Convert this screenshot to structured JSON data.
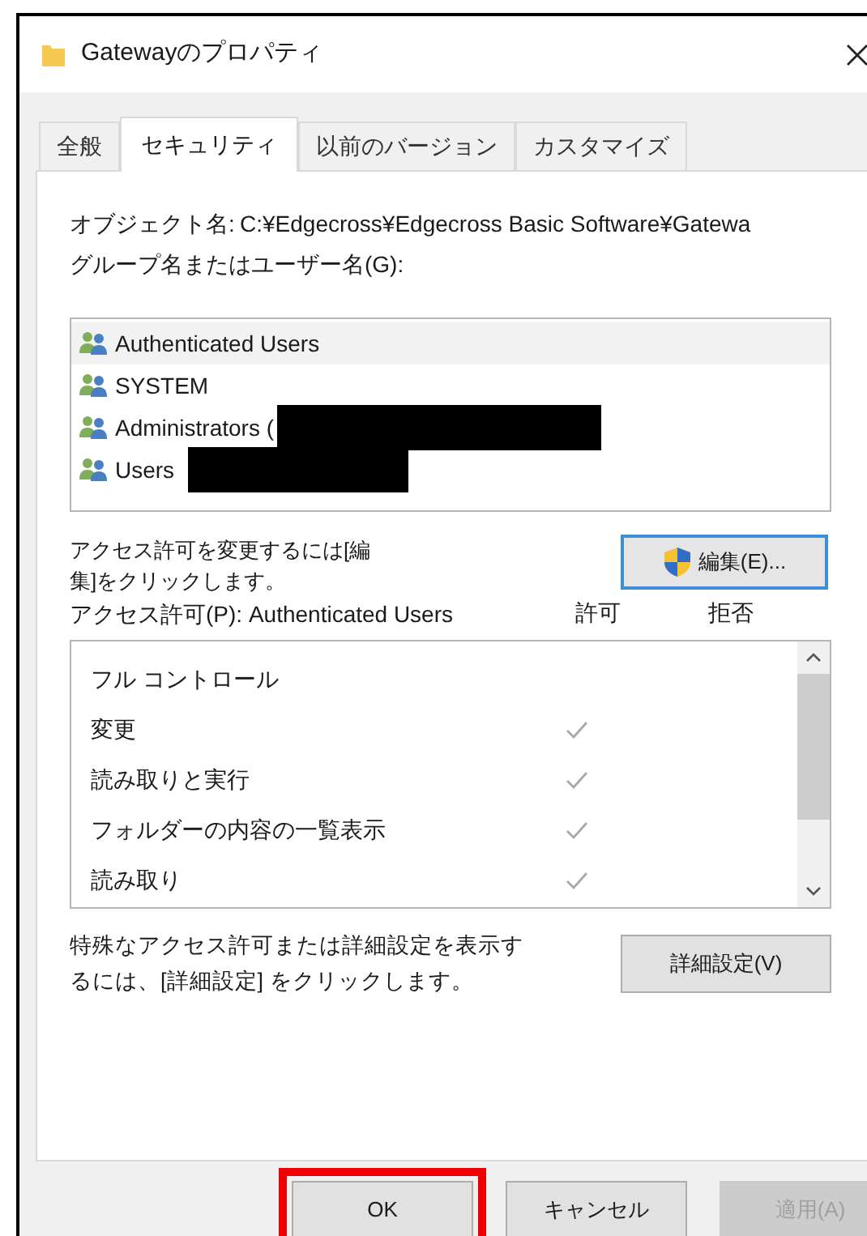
{
  "window": {
    "title": "Gatewayのプロパティ"
  },
  "tabs": [
    {
      "label": "全般",
      "selected": false
    },
    {
      "label": "セキュリティ",
      "selected": true
    },
    {
      "label": "以前のバージョン",
      "selected": false
    },
    {
      "label": "カスタマイズ",
      "selected": false
    }
  ],
  "object_name": {
    "label": "オブジェクト名:",
    "value": "C:¥Edgecross¥Edgecross Basic Software¥Gatewa"
  },
  "group_label": "グループ名またはユーザー名(G):",
  "principals": [
    {
      "name": "Authenticated Users",
      "selected": true,
      "redacted": false
    },
    {
      "name": "SYSTEM",
      "selected": false,
      "redacted": false
    },
    {
      "name": "Administrators (",
      "selected": false,
      "redacted": true
    },
    {
      "name": "Users",
      "selected": false,
      "redacted": true
    }
  ],
  "edit_hint": [
    "アクセス許可を変更するには[編",
    "集]をクリックします。"
  ],
  "edit_button": "編集(E)...",
  "permissions_label": "アクセス許可(P): Authenticated Users",
  "columns": [
    "許可",
    "拒否"
  ],
  "permissions": [
    {
      "name": "フル コントロール",
      "allow": false,
      "deny": false
    },
    {
      "name": "変更",
      "allow": true,
      "deny": false
    },
    {
      "name": "読み取りと実行",
      "allow": true,
      "deny": false
    },
    {
      "name": "フォルダーの内容の一覧表示",
      "allow": true,
      "deny": false
    },
    {
      "name": "読み取り",
      "allow": true,
      "deny": false
    }
  ],
  "advanced_hint": "特殊なアクセス許可または詳細設定を表示するには、[詳細設定] をクリックします。",
  "advanced_button": "詳細設定(V)",
  "buttons": [
    {
      "label": "OK",
      "disabled": false,
      "highlighted": true
    },
    {
      "label": "キャンセル",
      "disabled": false,
      "highlighted": false
    },
    {
      "label": "適用(A)",
      "disabled": true,
      "highlighted": false
    }
  ]
}
